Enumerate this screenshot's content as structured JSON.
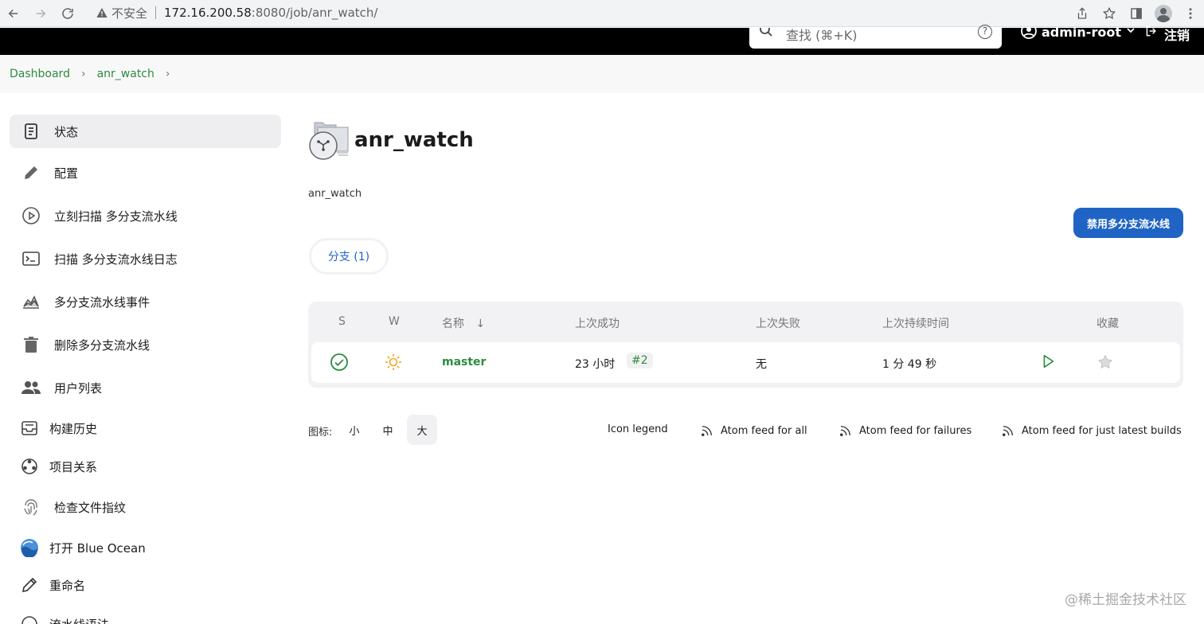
{
  "browser": {
    "security_label": "不安全",
    "url_host": "172.16.200.58",
    "url_path": ":8080/job/anr_watch/"
  },
  "header": {
    "search_placeholder": "查找 (⌘+K)",
    "help_label": "?",
    "user_name": "admin-root",
    "logout_label": "注销"
  },
  "breadcrumb": {
    "items": [
      {
        "label": "Dashboard"
      },
      {
        "label": "anr_watch"
      }
    ]
  },
  "sidebar": {
    "items": [
      {
        "label": "状态",
        "icon": "document-icon",
        "active": true
      },
      {
        "label": "配置",
        "icon": "pencil-icon"
      },
      {
        "label": "立刻扫描 多分支流水线",
        "icon": "play-circle-icon"
      },
      {
        "label": "扫描 多分支流水线日志",
        "icon": "terminal-icon"
      },
      {
        "label": "多分支流水线事件",
        "icon": "chart-icon"
      },
      {
        "label": "删除多分支流水线",
        "icon": "trash-icon"
      },
      {
        "label": "用户列表",
        "icon": "users-icon"
      },
      {
        "label": "构建历史",
        "icon": "inbox-icon"
      },
      {
        "label": "项目关系",
        "icon": "relationship-icon"
      },
      {
        "label": "检查文件指纹",
        "icon": "fingerprint-icon"
      },
      {
        "label": "打开 Blue Ocean",
        "icon": "blue-ocean-icon"
      },
      {
        "label": "重命名",
        "icon": "rename-pencil-icon"
      },
      {
        "label": "流水线语法",
        "icon": "help-circle-icon"
      }
    ]
  },
  "job": {
    "title": "anr_watch",
    "description": "anr_watch",
    "disable_button": "禁用多分支流水线",
    "tab_label": "分支 (1)"
  },
  "table": {
    "headers": {
      "s": "S",
      "w": "W",
      "name": "名称",
      "sort_arrow": "↓",
      "last_success": "上次成功",
      "last_failure": "上次失败",
      "last_duration": "上次持续时间",
      "favorite": "收藏"
    },
    "rows": [
      {
        "name": "master",
        "last_success_time": "23 小时",
        "last_success_build": "#2",
        "last_failure": "无",
        "last_duration": "1 分 49 秒"
      }
    ]
  },
  "footer": {
    "icon_label": "图标:",
    "sizes": [
      "小",
      "中",
      "大"
    ],
    "selected_size": "大",
    "links": {
      "icon_legend": "Icon legend",
      "atom_all": "Atom feed for all",
      "atom_failures": "Atom feed for failures",
      "atom_latest": "Atom feed for just latest builds"
    }
  },
  "watermark": "@稀土掘金技术社区",
  "colors": {
    "accent_green": "#2e8b3e",
    "primary_blue": "#1f64c4",
    "header_black": "#000000"
  }
}
